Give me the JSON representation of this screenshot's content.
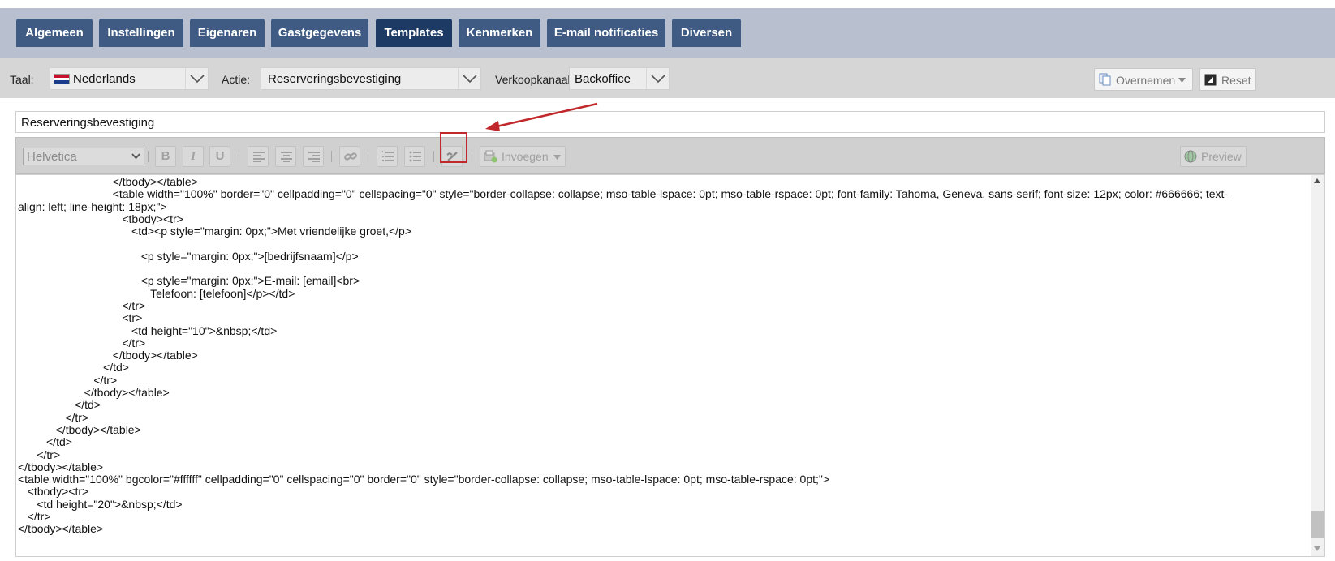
{
  "tabs": [
    {
      "label": "Algemeen",
      "active": false
    },
    {
      "label": "Instellingen",
      "active": false
    },
    {
      "label": "Eigenaren",
      "active": false
    },
    {
      "label": "Gastgegevens",
      "active": false
    },
    {
      "label": "Templates",
      "active": true
    },
    {
      "label": "Kenmerken",
      "active": false
    },
    {
      "label": "E-mail notificaties",
      "active": false
    },
    {
      "label": "Diversen",
      "active": false
    }
  ],
  "options": {
    "taal_label": "Taal:",
    "taal_value": "Nederlands",
    "actie_label": "Actie:",
    "actie_value": "Reserveringsbevestiging",
    "kanaal_label": "Verkoopkanaal:",
    "kanaal_value": "Backoffice",
    "overnemen_label": "Overnemen",
    "reset_label": "Reset"
  },
  "subject": "Reserveringsbevestiging",
  "toolbar": {
    "font_value": "Helvetica",
    "bold": "B",
    "italic": "I",
    "underline": "U",
    "invoegen_label": "Invoegen",
    "preview_label": "Preview"
  },
  "editor_lines": [
    "                              </tbody></table>",
    "                              <table width=\"100%\" border=\"0\" cellpadding=\"0\" cellspacing=\"0\" style=\"border-collapse: collapse; mso-table-lspace: 0pt; mso-table-rspace: 0pt; font-family: Tahoma, Geneva, sans-serif; font-size: 12px; color: #666666; text-",
    "align: left; line-height: 18px;\">",
    "                                 <tbody><tr>",
    "                                    <td><p style=\"margin: 0px;\">Met vriendelijke groet,</p>",
    "",
    "                                       <p style=\"margin: 0px;\">[bedrijfsnaam]</p>",
    "",
    "                                       <p style=\"margin: 0px;\">E-mail: [email]<br>",
    "                                          Telefoon: [telefoon]</p></td>",
    "                                 </tr>",
    "                                 <tr>",
    "                                    <td height=\"10\">&nbsp;</td>",
    "                                 </tr>",
    "                              </tbody></table>",
    "                           </td>",
    "                        </tr>",
    "                     </tbody></table>",
    "                  </td>",
    "               </tr>",
    "            </tbody></table>",
    "         </td>",
    "      </tr>",
    "</tbody></table>",
    "<table width=\"100%\" bgcolor=\"#ffffff\" cellpadding=\"0\" cellspacing=\"0\" border=\"0\" style=\"border-collapse: collapse; mso-table-lspace: 0pt; mso-table-rspace: 0pt;\">",
    "   <tbody><tr>",
    "      <td height=\"20\">&nbsp;</td>",
    "   </tr>",
    "</tbody></table>"
  ],
  "colors": {
    "tab_bg": "#3f5b84",
    "tab_active_bg": "#1d3a64",
    "tabbar_bg": "#b8c0d0",
    "highlight": "#c0282b"
  }
}
